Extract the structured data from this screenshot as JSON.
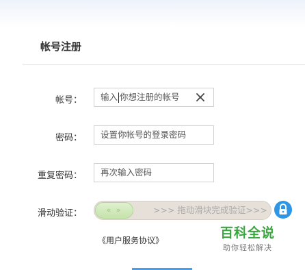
{
  "form": {
    "title": "帐号注册",
    "account": {
      "label": "帐号：",
      "value_before_caret": "输入",
      "value_after_caret": "你想注册的帐号"
    },
    "password": {
      "label": "密码：",
      "placeholder": "设置你帐号的登录密码"
    },
    "confirm": {
      "label": "重复密码：",
      "placeholder": "再次输入密码"
    },
    "slider": {
      "label": "滑动验证：",
      "knob_text": "«  »",
      "hint": ">>> 拖动滑块完成验证>>>"
    },
    "agreement": "《用户服务协议》"
  },
  "watermark": {
    "main": "百科全说",
    "sub": "助你轻松解决"
  },
  "colors": {
    "accent": "#2f96e6",
    "slider_knob": "#c6e3ac",
    "watermark": "#3aa63f"
  }
}
